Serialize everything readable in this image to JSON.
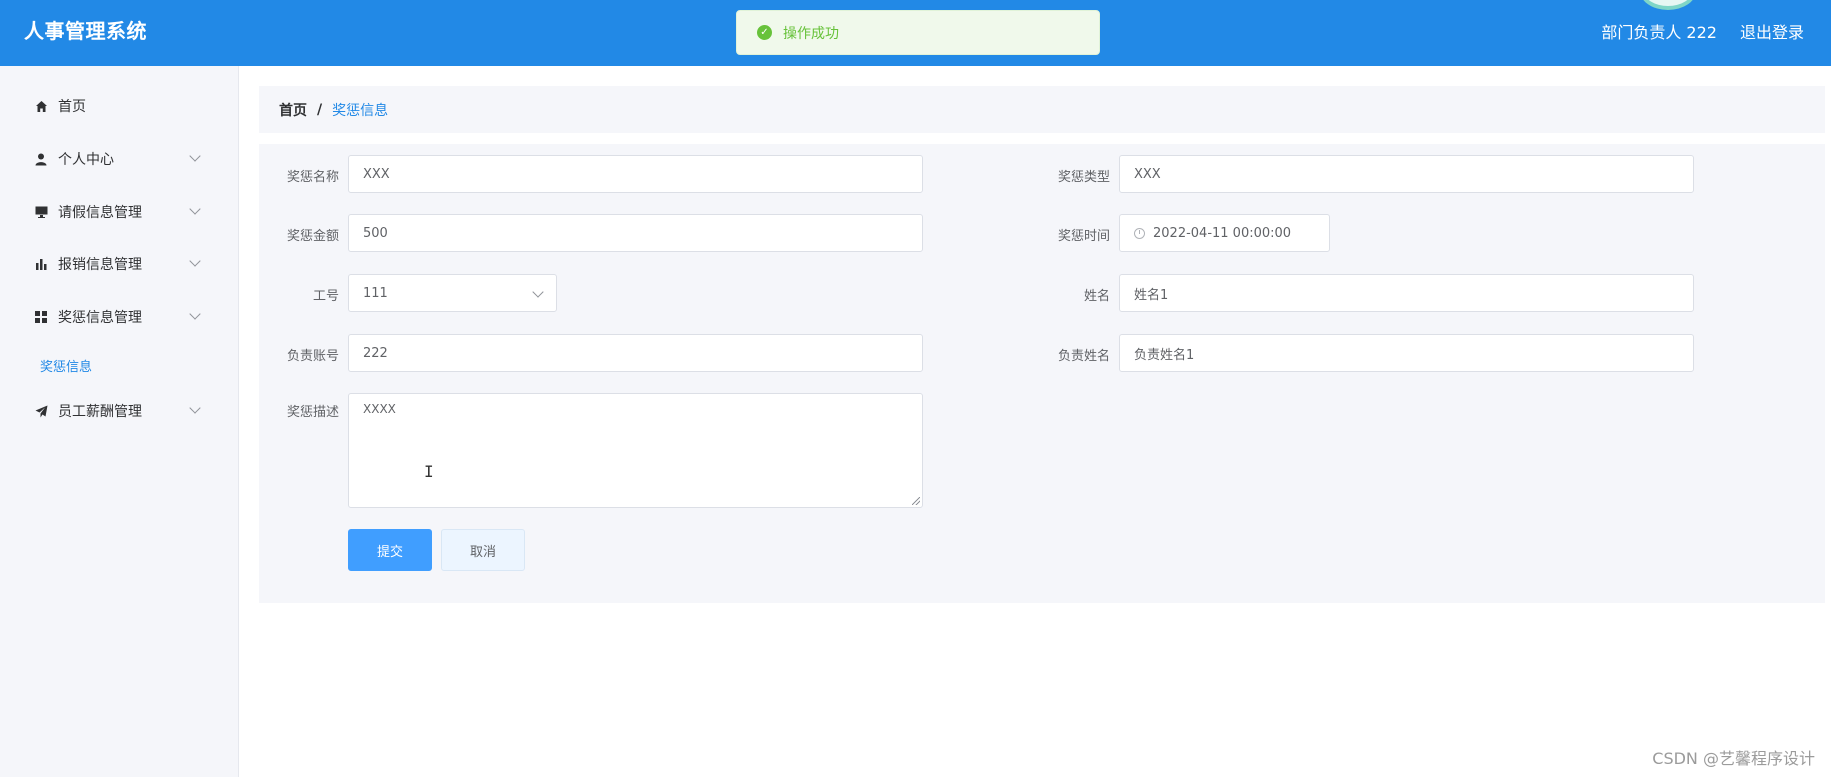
{
  "header": {
    "app_title": "人事管理系统",
    "user_label": "部门负责人 222",
    "logout_label": "退出登录"
  },
  "toast": {
    "message": "操作成功"
  },
  "sidebar": {
    "items": [
      {
        "label": "首页",
        "icon": "home-icon"
      },
      {
        "label": "个人中心",
        "icon": "user-icon"
      },
      {
        "label": "请假信息管理",
        "icon": "monitor-icon"
      },
      {
        "label": "报销信息管理",
        "icon": "bar-chart-icon"
      },
      {
        "label": "奖惩信息管理",
        "icon": "grid-icon"
      },
      {
        "label": "员工薪酬管理",
        "icon": "send-icon"
      }
    ],
    "active_submenu": "奖惩信息"
  },
  "breadcrumb": {
    "home": "首页",
    "separator": "/",
    "current": "奖惩信息"
  },
  "form": {
    "name": {
      "label": "奖惩名称",
      "value": "XXX"
    },
    "type": {
      "label": "奖惩类型",
      "value": "XXX"
    },
    "amount": {
      "label": "奖惩金额",
      "value": "500"
    },
    "time": {
      "label": "奖惩时间",
      "value": "2022-04-11 00:00:00"
    },
    "emp_no": {
      "label": "工号",
      "value": "111"
    },
    "emp_name": {
      "label": "姓名",
      "value": "姓名1"
    },
    "manager_account": {
      "label": "负责账号",
      "value": "222"
    },
    "manager_name": {
      "label": "负责姓名",
      "value": "负责姓名1"
    },
    "description": {
      "label": "奖惩描述",
      "value": "XXXX"
    },
    "submit_label": "提交",
    "cancel_label": "取消"
  },
  "watermark": "CSDN @艺馨程序设计",
  "colors": {
    "header_bg": "#2289e6",
    "primary": "#409eff",
    "success": "#67c23a",
    "sidebar_bg": "#f5f6fa"
  }
}
